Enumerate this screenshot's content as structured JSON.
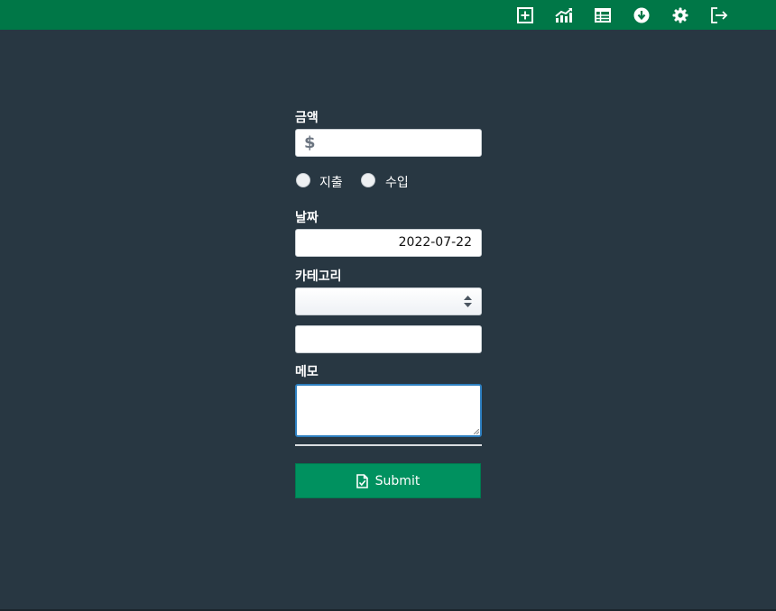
{
  "nav": {
    "items": [
      {
        "icon": "add-square-icon",
        "label": ""
      },
      {
        "icon": "chart-line-icon",
        "label": ""
      },
      {
        "icon": "table-icon",
        "label": ""
      },
      {
        "icon": "download-circle-icon",
        "label": ""
      },
      {
        "icon": "gear-icon",
        "label": ""
      },
      {
        "icon": "logout-icon",
        "label": ""
      }
    ],
    "color": "#007747"
  },
  "form": {
    "amount": {
      "label": "금액",
      "currency_symbol": "$",
      "value": ""
    },
    "type": {
      "options": [
        {
          "label": "지출",
          "checked": false
        },
        {
          "label": "수입",
          "checked": false
        }
      ]
    },
    "date": {
      "label": "날짜",
      "value": "2022-07-22"
    },
    "category": {
      "label": "카테고리",
      "selected": "",
      "extra_value": ""
    },
    "memo": {
      "label": "메모",
      "value": ""
    },
    "submit": {
      "label": "Submit",
      "icon": "file-check-icon",
      "color": "#00915f"
    }
  },
  "colors": {
    "background": "#283742",
    "accent": "#007747"
  }
}
